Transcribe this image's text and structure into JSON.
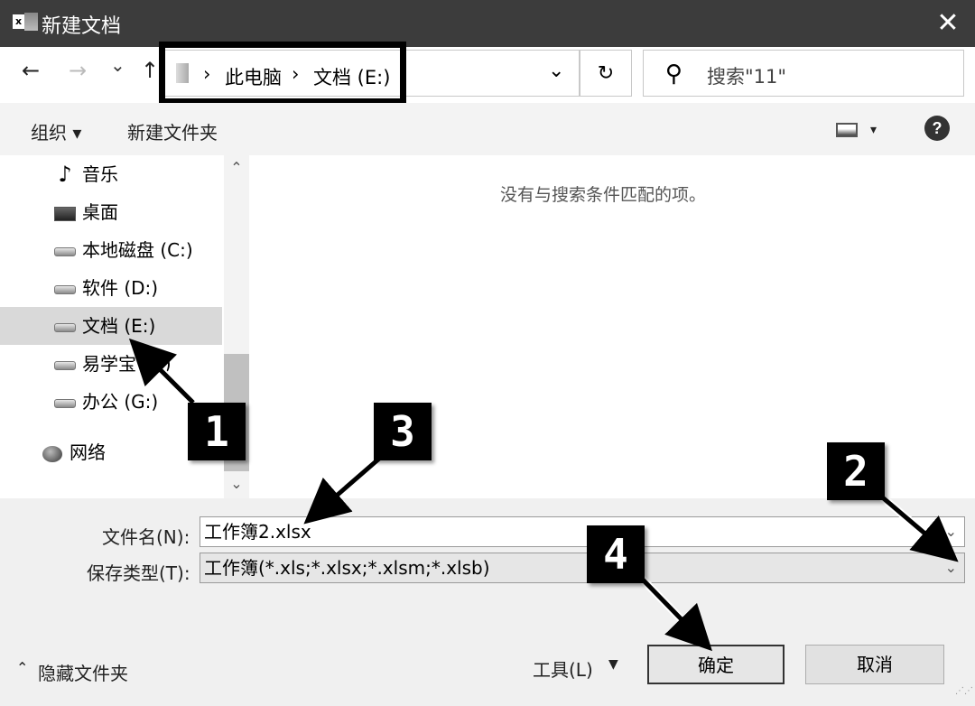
{
  "window": {
    "title": "新建文档",
    "app_icon": "excel-icon",
    "close_glyph": "✕"
  },
  "nav": {
    "back": "←",
    "forward": "→",
    "recent": "⌄",
    "up": "↑"
  },
  "address": {
    "separator": "›",
    "crumbs": [
      "此电脑",
      "文档 (E:)"
    ],
    "dropdown": "⌄",
    "refresh": "↻"
  },
  "search": {
    "placeholder": "搜索\"11\""
  },
  "toolbar": {
    "organize": "组织 ▾",
    "new_folder": "新建文件夹",
    "view": "▾",
    "help": "?"
  },
  "sidebar": {
    "items": [
      {
        "label": "音乐",
        "icon": "music-icon"
      },
      {
        "label": "桌面",
        "icon": "desktop-icon"
      },
      {
        "label": "本地磁盘 (C:)",
        "icon": "system-drive-icon"
      },
      {
        "label": "软件 (D:)",
        "icon": "drive-icon"
      },
      {
        "label": "文档 (E:)",
        "icon": "drive-icon",
        "selected": true
      },
      {
        "label": "易学宝 (F:)",
        "icon": "drive-icon"
      },
      {
        "label": "办公 (G:)",
        "icon": "drive-icon"
      },
      {
        "label": "网络",
        "icon": "network-icon"
      }
    ]
  },
  "main": {
    "empty_message": "没有与搜索条件匹配的项。"
  },
  "form": {
    "filename_label": "文件名(N):",
    "filename_value": "工作簿2.xlsx",
    "filetype_label": "保存类型(T):",
    "filetype_value": "工作簿(*.xls;*.xlsx;*.xlsm;*.xlsb)"
  },
  "footer": {
    "hide_folders": "隐藏文件夹",
    "tools": "工具(L)",
    "tools_arrow": "▼",
    "ok": "确定",
    "cancel": "取消"
  },
  "callouts": [
    "1",
    "2",
    "3",
    "4"
  ]
}
